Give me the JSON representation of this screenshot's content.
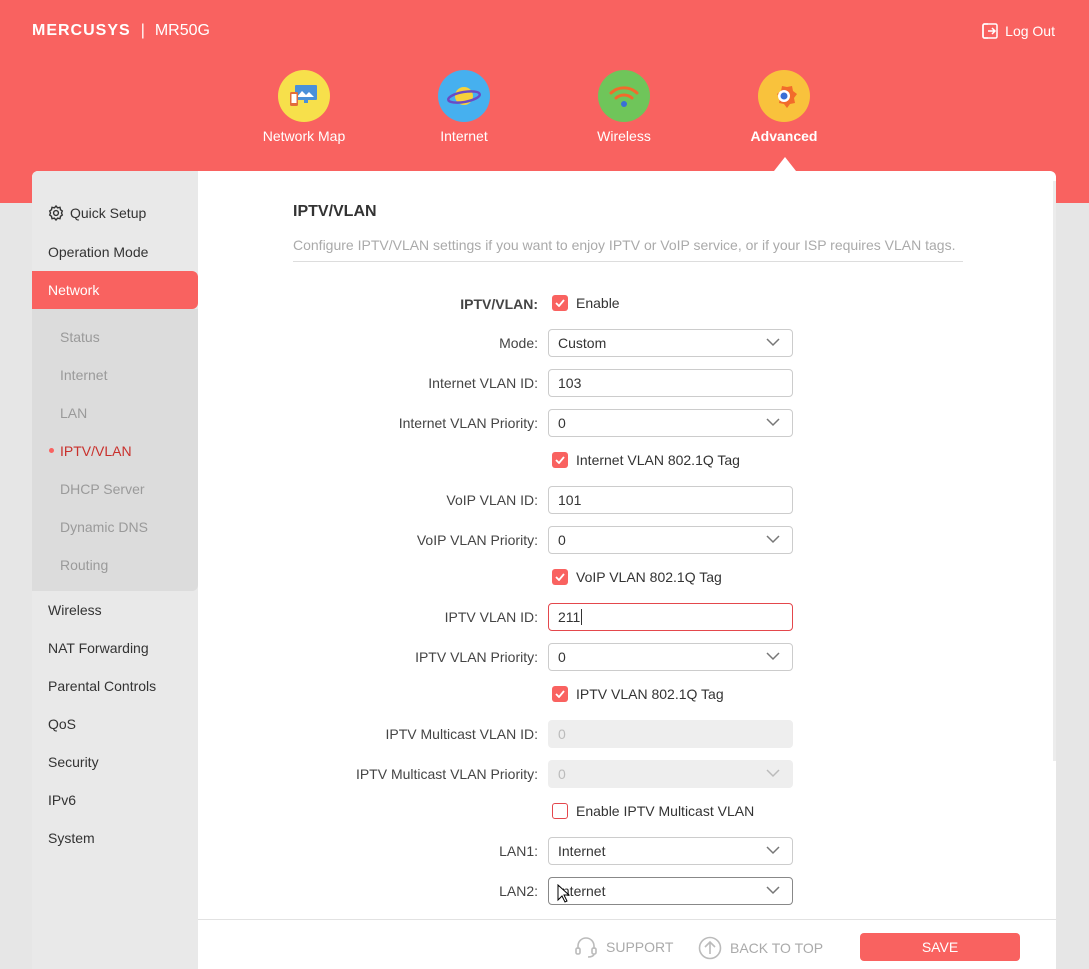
{
  "header": {
    "brand": "MERCUSYS",
    "model": "MR50G",
    "logout_label": "Log Out",
    "accent": "#f96260"
  },
  "nav": [
    {
      "label": "Network Map",
      "icon": "network-map-icon"
    },
    {
      "label": "Internet",
      "icon": "internet-planet-icon"
    },
    {
      "label": "Wireless",
      "icon": "wifi-icon"
    },
    {
      "label": "Advanced",
      "icon": "gear-icon",
      "active": true
    }
  ],
  "sidebar": {
    "quick_setup": "Quick Setup",
    "items": [
      "Operation Mode",
      "Network",
      "Wireless",
      "NAT Forwarding",
      "Parental Controls",
      "QoS",
      "Security",
      "IPv6",
      "System"
    ],
    "network_sub": [
      "Status",
      "Internet",
      "LAN",
      "IPTV/VLAN",
      "DHCP Server",
      "Dynamic DNS",
      "Routing"
    ],
    "active_item": "Network",
    "current_sub": "IPTV/VLAN"
  },
  "main": {
    "title": "IPTV/VLAN",
    "description": "Configure IPTV/VLAN settings if you want to enjoy IPTV or VoIP service, or if your ISP requires VLAN tags.",
    "iptv_vlan_label": "IPTV/VLAN:",
    "enable_label": "Enable",
    "mode_label": "Mode:",
    "mode_value": "Custom",
    "internet_vlan_id_label": "Internet VLAN ID:",
    "internet_vlan_id": "103",
    "internet_vlan_priority_label": "Internet VLAN Priority:",
    "internet_vlan_priority": "0",
    "internet_tag_label": "Internet VLAN 802.1Q Tag",
    "voip_vlan_id_label": "VoIP VLAN ID:",
    "voip_vlan_id": "101",
    "voip_vlan_priority_label": "VoIP VLAN Priority:",
    "voip_vlan_priority": "0",
    "voip_tag_label": "VoIP VLAN 802.1Q Tag",
    "iptv_vlan_id_label": "IPTV VLAN ID:",
    "iptv_vlan_id": "211",
    "iptv_vlan_priority_label": "IPTV VLAN Priority:",
    "iptv_vlan_priority": "0",
    "iptv_tag_label": "IPTV VLAN 802.1Q Tag",
    "multicast_id_label": "IPTV Multicast VLAN ID:",
    "multicast_id": "0",
    "multicast_priority_label": "IPTV Multicast VLAN Priority:",
    "multicast_priority": "0",
    "enable_multicast_label": "Enable IPTV Multicast VLAN",
    "lan1_label": "LAN1:",
    "lan1_value": "Internet",
    "lan2_label": "LAN2:",
    "lan2_value": "Internet"
  },
  "footer": {
    "support": "SUPPORT",
    "back_to_top": "BACK TO TOP",
    "save": "SAVE"
  }
}
